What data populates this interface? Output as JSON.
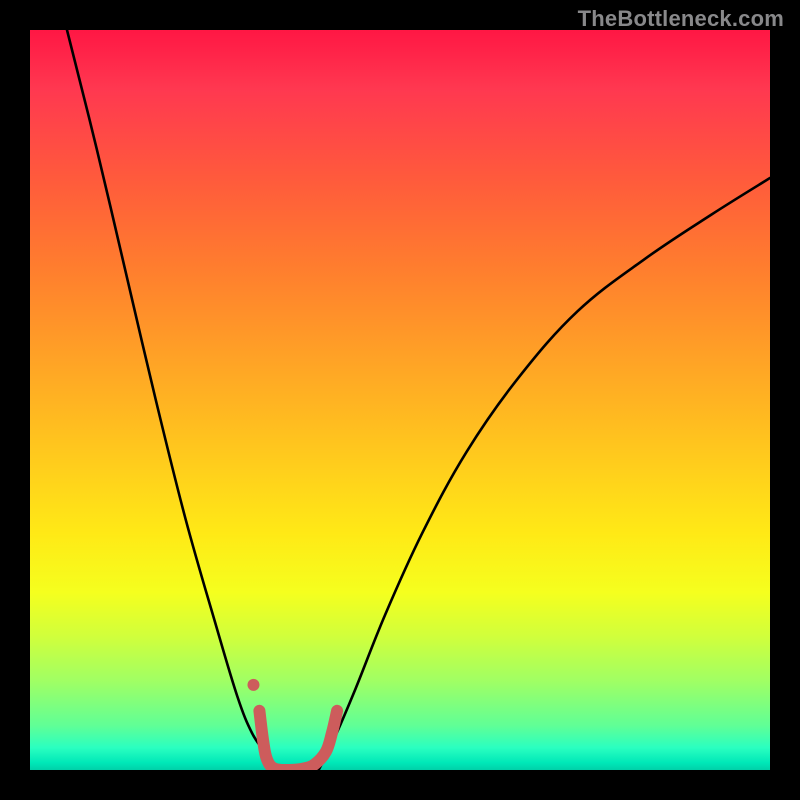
{
  "watermark": "TheBottleneck.com",
  "chart_data": {
    "type": "line",
    "title": "",
    "xlabel": "",
    "ylabel": "",
    "xlim": [
      0,
      100
    ],
    "ylim": [
      0,
      100
    ],
    "grid": false,
    "legend": false,
    "annotations": [],
    "series": [
      {
        "name": "left-branch",
        "color": "#000000",
        "x": [
          5,
          9,
          13,
          17,
          21,
          25,
          28,
          30,
          32,
          33
        ],
        "y": [
          100,
          84,
          67,
          50,
          34,
          20,
          10,
          5,
          2,
          0
        ]
      },
      {
        "name": "right-branch",
        "color": "#000000",
        "x": [
          39,
          41,
          44,
          48,
          53,
          59,
          66,
          74,
          83,
          92,
          100
        ],
        "y": [
          0,
          4,
          11,
          21,
          32,
          43,
          53,
          62,
          69,
          75,
          80
        ]
      },
      {
        "name": "bottom-highlight",
        "color": "#cd5c5c",
        "x": [
          31.0,
          31.5,
          32.0,
          33.0,
          35.0,
          37.0,
          38.5,
          40.0,
          40.8,
          41.5
        ],
        "y": [
          8.0,
          4.0,
          1.5,
          0.2,
          0.0,
          0.2,
          0.8,
          2.5,
          5.0,
          8.0
        ]
      },
      {
        "name": "highlight-dot",
        "color": "#cd5c5c",
        "x": [
          30.2
        ],
        "y": [
          11.5
        ]
      }
    ]
  }
}
